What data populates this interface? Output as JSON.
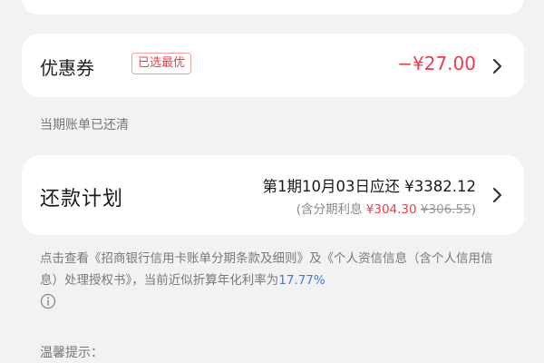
{
  "coupon": {
    "label": "优惠券",
    "badge": "已选最优",
    "amount": "−¥27.00"
  },
  "status": {
    "text": "当期账单已还清"
  },
  "plan": {
    "label": "还款计划",
    "line1": "第1期10月03日应还 ¥3382.12",
    "line2_prefix": "(含分期利息 ",
    "interest": "¥304.30",
    "original_interest": "¥306.55",
    "line2_suffix": ")"
  },
  "terms": {
    "text": "点击查看《招商银行信用卡账单分期条款及细则》及《个人资信信息（含个人信用信息）处理授权书》，当前近似折算年化利率为",
    "rate": "17.77%"
  },
  "tips": {
    "title": "温馨提示："
  },
  "icons": {
    "chevron": "chevron-right-icon",
    "info": "info-icon"
  },
  "colors": {
    "accent_red": "#e8404a",
    "link_blue": "#4a78c8",
    "background": "#f2f2f4"
  }
}
